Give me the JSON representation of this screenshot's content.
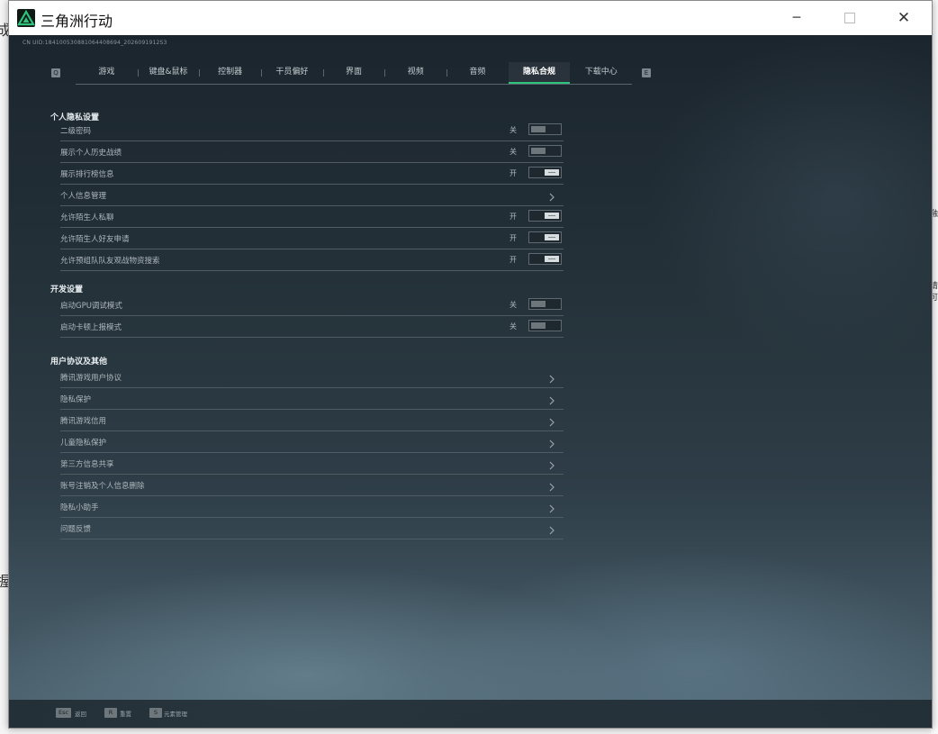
{
  "window": {
    "title": "三角洲行动",
    "minimize_glyph": "─",
    "close_glyph": "✕"
  },
  "uid_text": "CN UID:184100530881064408694_2026091912S3",
  "tabs": {
    "left_key": "Q",
    "right_key": "E",
    "items": [
      {
        "label": "游戏",
        "active": false
      },
      {
        "label": "键盘&鼠标",
        "active": false
      },
      {
        "label": "控制器",
        "active": false
      },
      {
        "label": "干员偏好",
        "active": false
      },
      {
        "label": "界面",
        "active": false
      },
      {
        "label": "视频",
        "active": false
      },
      {
        "label": "音频",
        "active": false
      },
      {
        "label": "隐私合规",
        "active": true
      },
      {
        "label": "下载中心",
        "active": false
      }
    ]
  },
  "sections": {
    "personal": {
      "title": "个人隐私设置",
      "rows": [
        {
          "label": "二级密码",
          "state": "关",
          "toggle": "off"
        },
        {
          "label": "展示个人历史战绩",
          "state": "关",
          "toggle": "off"
        },
        {
          "label": "展示排行榜信息",
          "state": "开",
          "toggle": "on"
        },
        {
          "label": "个人信息管理",
          "state": "",
          "toggle": "chevron"
        },
        {
          "label": "允许陌生人私聊",
          "state": "开",
          "toggle": "on"
        },
        {
          "label": "允许陌生人好友申请",
          "state": "开",
          "toggle": "on"
        },
        {
          "label": "允许预组队队友观战物资搜索",
          "state": "开",
          "toggle": "on"
        }
      ]
    },
    "dev": {
      "title": "开发设置",
      "rows": [
        {
          "label": "启动GPU调试模式",
          "state": "关",
          "toggle": "off"
        },
        {
          "label": "启动卡顿上报模式",
          "state": "关",
          "toggle": "off"
        }
      ]
    },
    "agreements": {
      "title": "用户协议及其他",
      "rows": [
        {
          "label": "腾讯游戏用户协议"
        },
        {
          "label": "隐私保护"
        },
        {
          "label": "腾讯游戏信用"
        },
        {
          "label": "儿童隐私保护"
        },
        {
          "label": "第三方信息共享"
        },
        {
          "label": "账号注销及个人信息删除"
        },
        {
          "label": "隐私小助手"
        },
        {
          "label": "问题反馈"
        }
      ]
    }
  },
  "footer": {
    "items": [
      {
        "key": "Esc",
        "label": "返回"
      },
      {
        "key": "R",
        "label": "重置"
      },
      {
        "key": "S",
        "label": "元素管理"
      }
    ]
  },
  "background": {
    "frag1": "成",
    "frag2": "握",
    "frag3": "请",
    "frag4": "可",
    "frag5": "融"
  },
  "colors": {
    "accent": "#2fc27b",
    "panel_bg": "#243139",
    "text": "#aeb7bc"
  }
}
